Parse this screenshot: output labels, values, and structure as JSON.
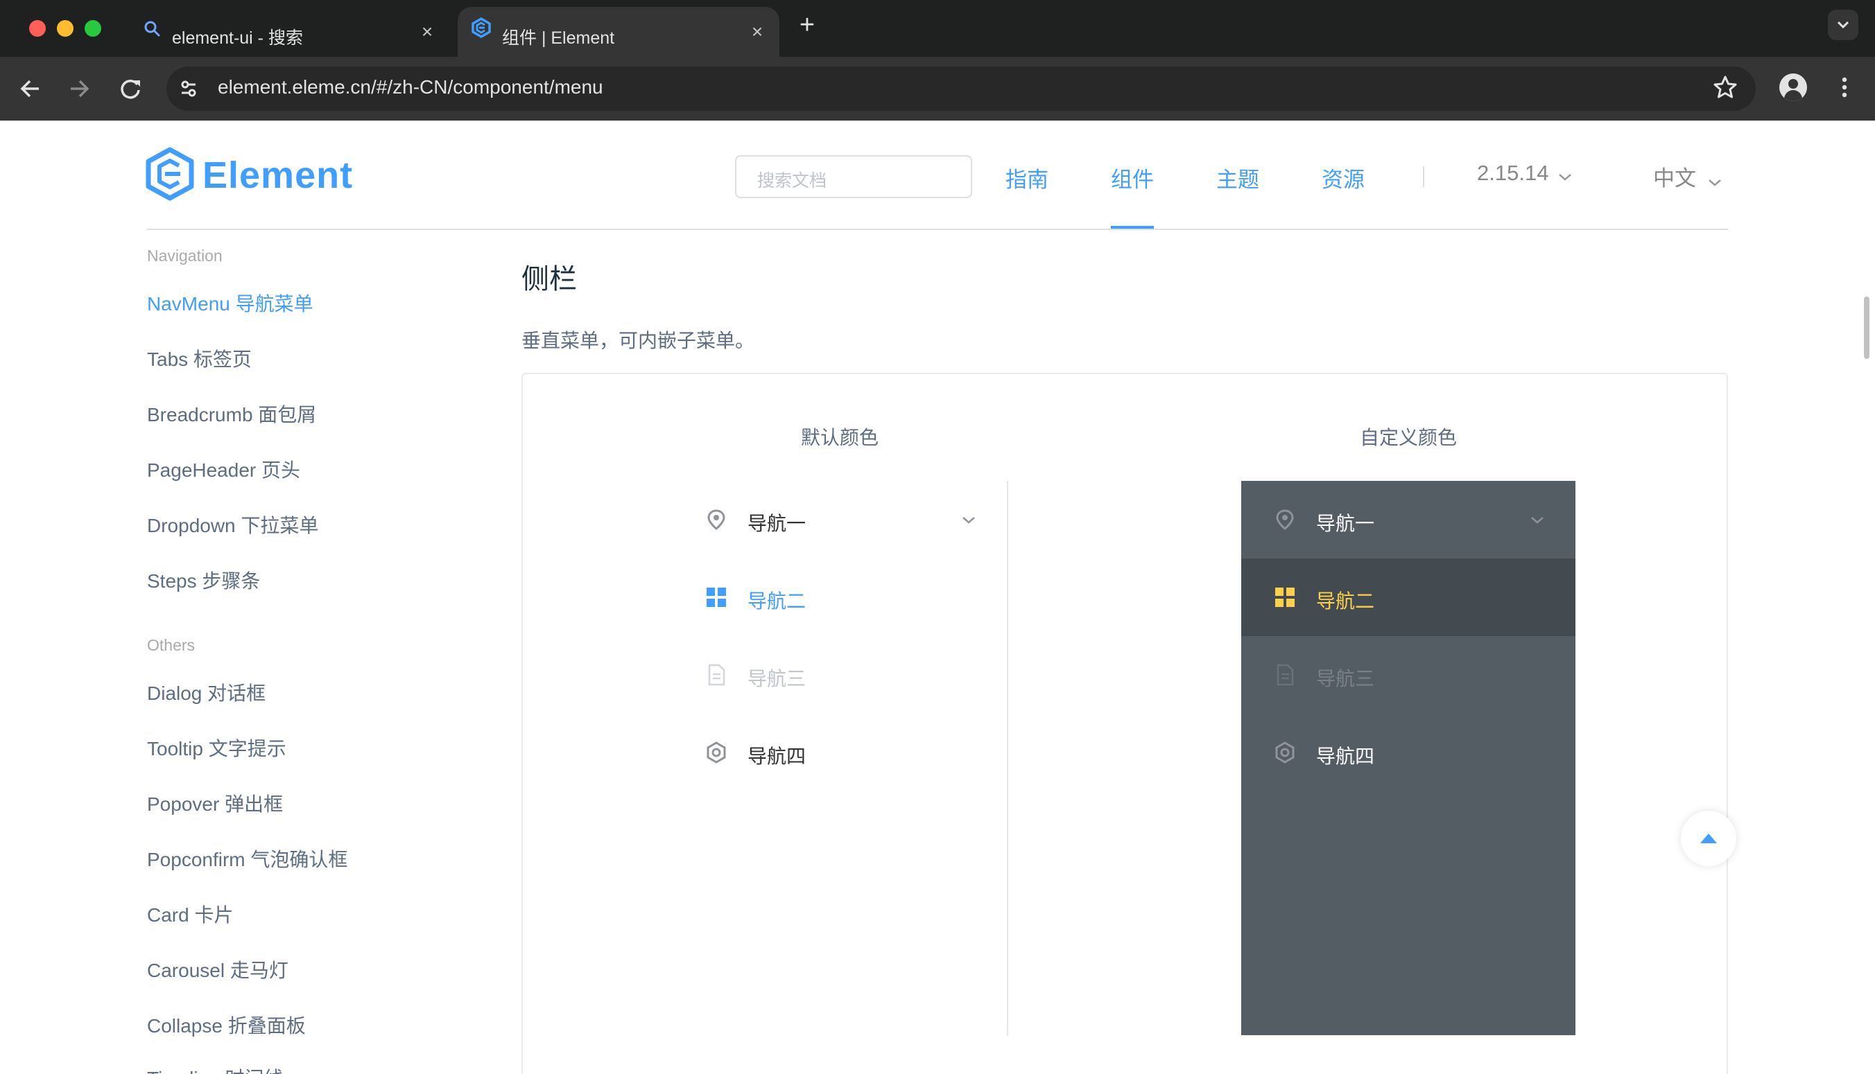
{
  "browser": {
    "tabs": [
      {
        "title": "element-ui - 搜索",
        "icon": "search-icon"
      },
      {
        "title": "组件 | Element",
        "icon": "element-logo-icon"
      }
    ],
    "url": "element.eleme.cn/#/zh-CN/component/menu"
  },
  "header": {
    "logo_text": "Element",
    "search_placeholder": "搜索文档",
    "nav": [
      "指南",
      "组件",
      "主题",
      "资源"
    ],
    "active_nav": "组件",
    "version": "2.15.14",
    "language": "中文"
  },
  "sidebar": {
    "sections": [
      {
        "title": "Navigation",
        "items": [
          "NavMenu 导航菜单",
          "Tabs 标签页",
          "Breadcrumb 面包屑",
          "PageHeader 页头",
          "Dropdown 下拉菜单",
          "Steps 步骤条"
        ]
      },
      {
        "title": "Others",
        "items": [
          "Dialog 对话框",
          "Tooltip 文字提示",
          "Popover 弹出框",
          "Popconfirm 气泡确认框",
          "Card 卡片",
          "Carousel 走马灯",
          "Collapse 折叠面板",
          "Timeline 时间线"
        ]
      }
    ],
    "active_item": "NavMenu 导航菜单"
  },
  "main": {
    "section_title": "侧栏",
    "description": "垂直菜单，可内嵌子菜单。",
    "demo": {
      "left_caption": "默认颜色",
      "right_caption": "自定义颜色",
      "menu_items": [
        {
          "label": "导航一",
          "icon": "location-icon",
          "state": "submenu"
        },
        {
          "label": "导航二",
          "icon": "menu-grid-icon",
          "state": "active"
        },
        {
          "label": "导航三",
          "icon": "document-icon",
          "state": "disabled"
        },
        {
          "label": "导航四",
          "icon": "setting-icon",
          "state": "normal"
        }
      ]
    }
  },
  "colors": {
    "primary": "#409eff",
    "custom_menu_bg": "#545c64",
    "custom_menu_active_bg": "#434a50",
    "custom_active_text": "#ffd04b",
    "text_main": "#303133",
    "sidebar_text": "#5e6d82"
  }
}
